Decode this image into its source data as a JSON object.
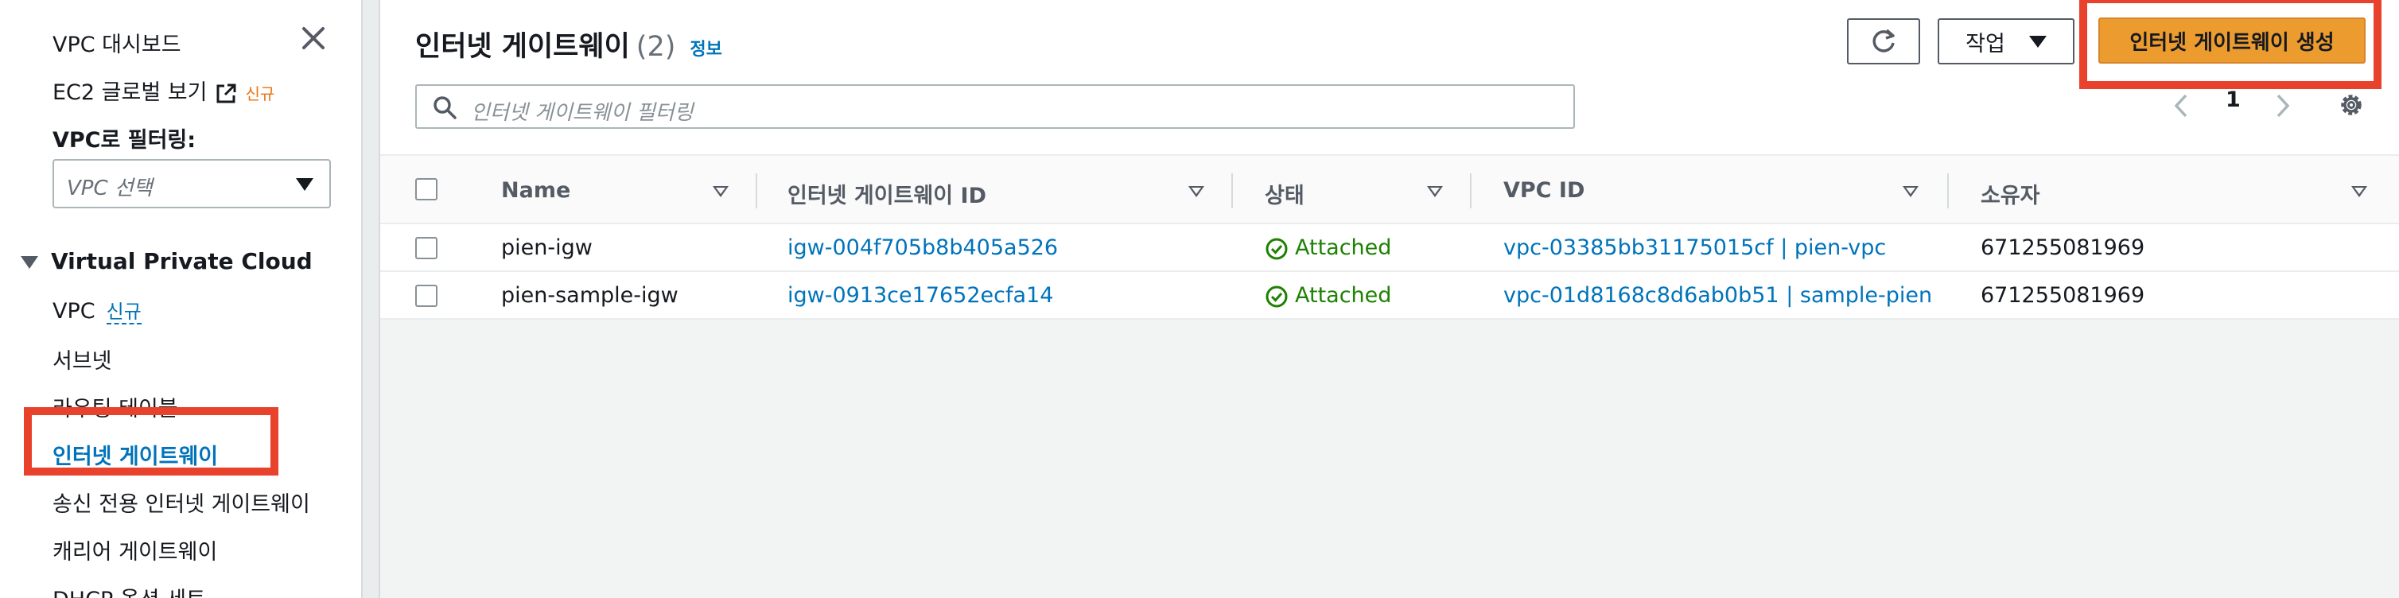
{
  "sidebar": {
    "dashboard": "VPC 대시보드",
    "ec2_global_view": "EC2 글로벌 보기",
    "ec2_global_view_badge": "신규",
    "filter_label": "VPC로 필터링:",
    "filter_placeholder": "VPC 선택",
    "section_title": "Virtual Private Cloud",
    "items": [
      {
        "label": "VPC",
        "badge": "신규"
      },
      {
        "label": "서브넷"
      },
      {
        "label": "라우팅 테이블"
      },
      {
        "label": "인터넷 게이트웨이"
      },
      {
        "label": "송신 전용 인터넷 게이트웨이"
      },
      {
        "label": "캐리어 게이트웨이"
      },
      {
        "label": "DHCP 옵션 세트"
      }
    ]
  },
  "header": {
    "title": "인터넷 게이트웨이",
    "count": "(2)",
    "info": "정보",
    "actions_label": "작업",
    "create_label": "인터넷 게이트웨이 생성"
  },
  "search": {
    "placeholder": "인터넷 게이트웨이 필터링"
  },
  "pagination": {
    "current_page": "1"
  },
  "table": {
    "columns": [
      "Name",
      "인터넷 게이트웨이 ID",
      "상태",
      "VPC ID",
      "소유자"
    ],
    "rows": [
      {
        "name": "pien-igw",
        "id": "igw-004f705b8b405a526",
        "state": "Attached",
        "vpc": "vpc-03385bb31175015cf | pien-vpc",
        "owner": "671255081969"
      },
      {
        "name": "pien-sample-igw",
        "id": "igw-0913ce17652ecfa14",
        "state": "Attached",
        "vpc": "vpc-01d8168c8d6ab0b51 | sample-pien",
        "owner": "671255081969"
      }
    ]
  },
  "colors": {
    "link": "#0073bb",
    "primary_button": "#ec9c2f",
    "success": "#1d8102",
    "highlight": "#e8412c"
  }
}
